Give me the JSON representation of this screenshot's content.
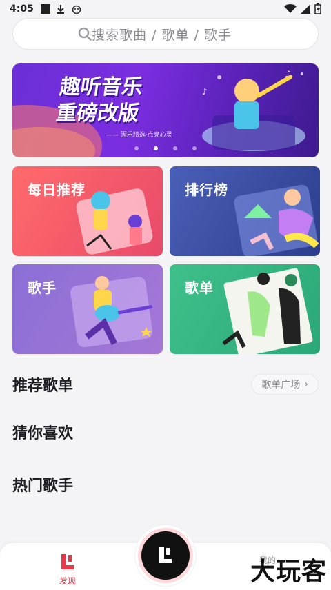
{
  "status_bar": {
    "time": "4:05"
  },
  "search": {
    "placeholder": "搜索歌曲 / 歌单 / 歌手"
  },
  "banner": {
    "title_line1": "趣听音乐",
    "title_line2": "重磅改版",
    "subtitle": "—— 固乐精选·点亮心灵"
  },
  "cards": [
    {
      "label": "每日推荐"
    },
    {
      "label": "排行榜"
    },
    {
      "label": "歌手"
    },
    {
      "label": "歌单"
    }
  ],
  "sections": {
    "recommended": "推荐歌单",
    "more": "歌单广场",
    "guess": "猜你喜欢",
    "hot_singers": "热门歌手"
  },
  "bottom_nav": {
    "discover": "发现",
    "mine": "我的"
  },
  "watermark": "大玩客",
  "colors": {
    "accent": "#e8384a"
  }
}
